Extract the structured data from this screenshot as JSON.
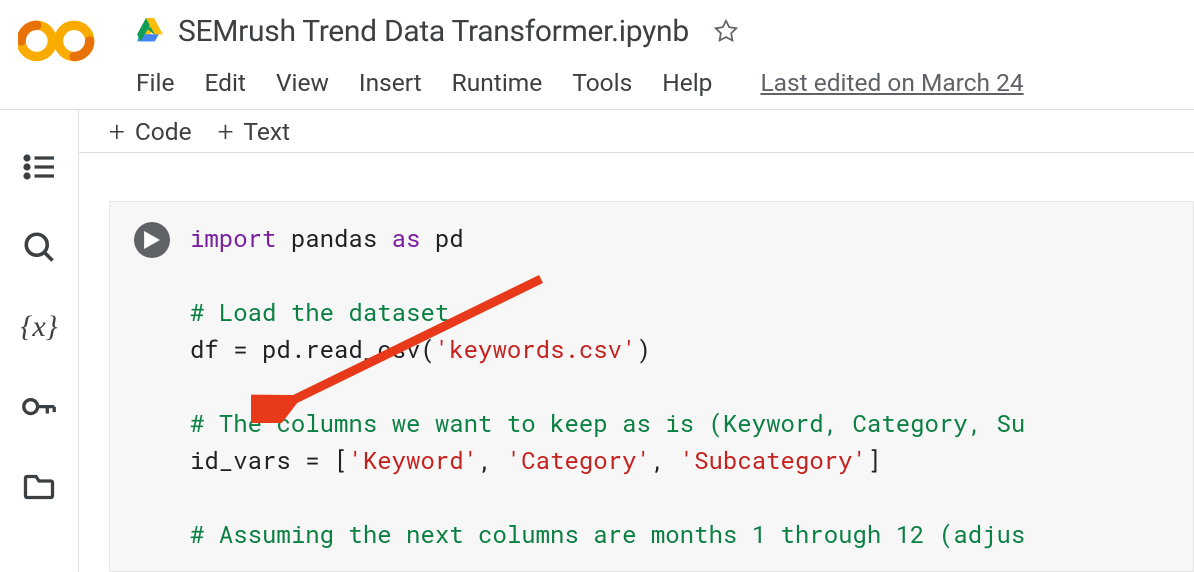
{
  "header": {
    "title": "SEMrush Trend Data Transformer.ipynb",
    "last_edited": "Last edited on March 24"
  },
  "menu": {
    "file": "File",
    "edit": "Edit",
    "view": "View",
    "insert": "Insert",
    "runtime": "Runtime",
    "tools": "Tools",
    "help": "Help"
  },
  "toolbar": {
    "code": "Code",
    "text": "Text"
  },
  "code": {
    "l1_import": "import",
    "l1_pandas": " pandas ",
    "l1_as": "as",
    "l1_pd": " pd",
    "l3_comment": "# Load the dataset",
    "l4_a": "df = pd.read_csv(",
    "l4_str": "'keywords.csv'",
    "l4_b": ")",
    "l6_comment": "# The columns we want to keep as is (Keyword, Category, Su",
    "l7_a": "id_vars = [",
    "l7_s1": "'Keyword'",
    "l7_c1": ", ",
    "l7_s2": "'Category'",
    "l7_c2": ", ",
    "l7_s3": "'Subcategory'",
    "l7_b": "]",
    "l9_comment": "# Assuming the next columns are months 1 through 12 (adjus"
  }
}
